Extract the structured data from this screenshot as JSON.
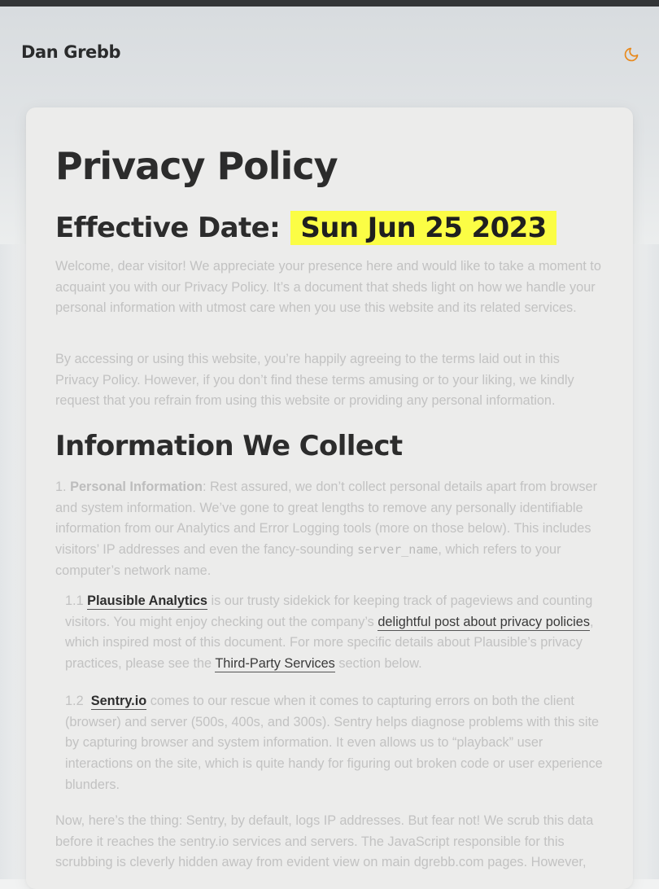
{
  "site": {
    "title": "Dan Grebb"
  },
  "icons": {
    "theme_toggle": "moon-icon"
  },
  "colors": {
    "accent": "#e8891c",
    "highlight": "#fbfd45"
  },
  "page": {
    "title": "Privacy Policy",
    "effective_label": "Effective Date:",
    "effective_date": "Sun Jun 25 2023",
    "intro_1": "Welcome, dear visitor! We appreciate your presence here and would like to take a moment to acquaint you with our Privacy Policy. It’s a document that sheds light on how we handle your personal information with utmost care when you use this website and its related services.",
    "intro_2": "By accessing or using this website, you’re happily agreeing to the terms laid out in this Privacy Policy. However, if you don’t find these terms amusing or to your liking, we kindly request that you refrain from using this website or providing any personal information."
  },
  "section_info": {
    "heading": "Information We Collect",
    "item_1_number": "1.",
    "item_1_title": "Personal Information",
    "item_1_text_a": ": Rest assured, we don’t collect personal details apart from browser and system information. We’ve gone to great lengths to remove any personally identifiable information from our Analytics and Error Logging tools (more on those below). This includes visitors’ IP addresses and even the fancy-sounding ",
    "item_1_code": "server_name",
    "item_1_text_b": ", which refers to your computer’s network name.",
    "sub_1_number": "1.1",
    "sub_1_link": "Plausible Analytics",
    "sub_1_text_a": " is our trusty sidekick for keeping track of pageviews and counting visitors. You might enjoy checking out the company’s ",
    "sub_1_link_2": "delightful post about privacy policies",
    "sub_1_text_b": ", which inspired most of this document. For more specific details about Plausible’s privacy practices, please see the ",
    "sub_1_link_3": "Third-Party Services",
    "sub_1_text_c": " section below.",
    "sub_2_number": "1.2",
    "sub_2_link": "Sentry.io",
    "sub_2_text": " comes to our rescue when it comes to capturing errors on both the client (browser) and server (500s, 400s, and 300s). Sentry helps diagnose problems with this site by capturing browser and system information. It even allows us to “playback” user interactions on the site, which is quite handy for figuring out broken code or user experience blunders.",
    "para_after": "Now, here’s the thing: Sentry, by default, logs IP addresses. But fear not! We scrub this data before it reaches the sentry.io services and servers. The JavaScript responsible for this scrubbing is cleverly hidden away from evident view on main dgrebb.com pages. However,"
  }
}
